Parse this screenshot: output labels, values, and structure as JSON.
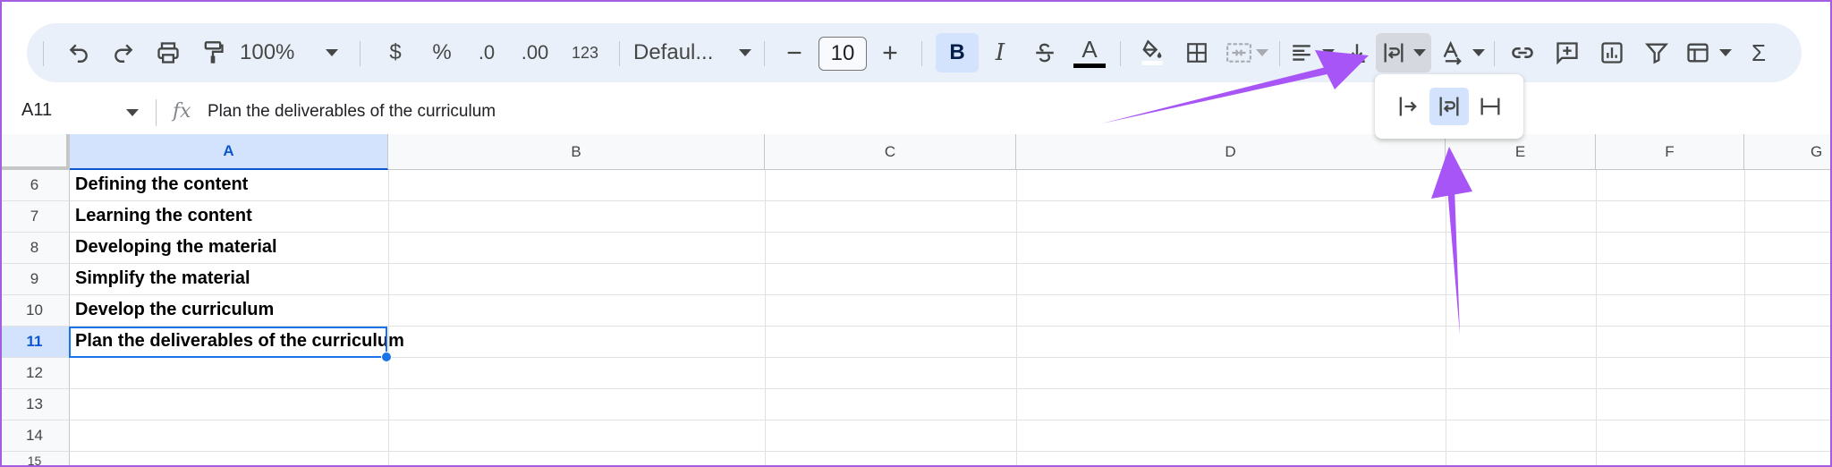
{
  "toolbar": {
    "zoom": "100%",
    "currency": "$",
    "percent": "%",
    "decrease_decimal": ".0",
    "increase_decimal": ".00",
    "number_format": "123",
    "font": "Defaul...",
    "font_size": "10",
    "bold": "B",
    "italic": "I",
    "text_color_letter": "A",
    "function_icon": "Σ"
  },
  "formula_bar": {
    "cell_ref": "A11",
    "fx": "fx",
    "content": "Plan the deliverables of the curriculum"
  },
  "columns": [
    "A",
    "B",
    "C",
    "D",
    "E",
    "F",
    "G"
  ],
  "rows": [
    {
      "num": "6",
      "a": "Defining the content"
    },
    {
      "num": "7",
      "a": "Learning the content"
    },
    {
      "num": "8",
      "a": "Developing the material"
    },
    {
      "num": "9",
      "a": "Simplify the material"
    },
    {
      "num": "10",
      "a": "Develop the curriculum"
    },
    {
      "num": "11",
      "a": "Plan the deliverables of the curriculum"
    },
    {
      "num": "12",
      "a": ""
    },
    {
      "num": "13",
      "a": ""
    },
    {
      "num": "14",
      "a": ""
    },
    {
      "num": "15",
      "a": ""
    }
  ],
  "selected_cell": "A11",
  "wrap_menu": [
    "overflow-icon",
    "wrap-icon",
    "clip-icon"
  ],
  "colors": {
    "accent": "#0b57d0",
    "selection": "#1a73e8",
    "arrow": "#a855f7",
    "toolbar_bg": "#eaf0fa"
  }
}
